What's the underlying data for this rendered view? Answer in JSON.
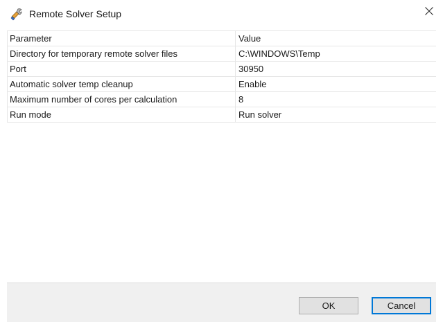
{
  "window": {
    "title": "Remote Solver Setup",
    "close_glyph": "✕"
  },
  "icons": {
    "title_icon": "tools-icon",
    "close_icon": "close-icon"
  },
  "grid": {
    "headers": [
      "Parameter",
      "Value"
    ],
    "rows": [
      {
        "parameter": "Directory for temporary remote solver files",
        "value": "C:\\WINDOWS\\Temp"
      },
      {
        "parameter": "Port",
        "value": "30950"
      },
      {
        "parameter": "Automatic solver temp cleanup",
        "value": "Enable"
      },
      {
        "parameter": "Maximum number of cores per calculation",
        "value": "8"
      },
      {
        "parameter": "Run mode",
        "value": "Run solver"
      }
    ]
  },
  "buttons": {
    "ok_label": "OK",
    "cancel_label": "Cancel"
  },
  "colors": {
    "accent": "#0078d7",
    "footer_bg": "#f0f0f0",
    "grid_line": "#e6e6e6"
  }
}
